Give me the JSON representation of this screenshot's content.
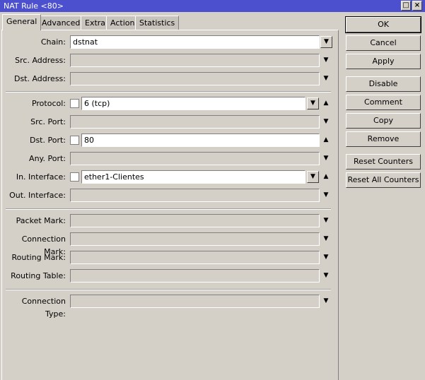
{
  "window": {
    "title": "NAT Rule <80>"
  },
  "tabs": [
    "General",
    "Advanced",
    "Extra",
    "Action",
    "Statistics"
  ],
  "fields": {
    "chain": {
      "label": "Chain:",
      "value": "dstnat"
    },
    "src_address": {
      "label": "Src. Address:",
      "value": ""
    },
    "dst_address": {
      "label": "Dst. Address:",
      "value": ""
    },
    "protocol": {
      "label": "Protocol:",
      "value": "6 (tcp)"
    },
    "src_port": {
      "label": "Src. Port:",
      "value": ""
    },
    "dst_port": {
      "label": "Dst. Port:",
      "value": "80"
    },
    "any_port": {
      "label": "Any. Port:",
      "value": ""
    },
    "in_interface": {
      "label": "In. Interface:",
      "value": "ether1-Clientes"
    },
    "out_interface": {
      "label": "Out. Interface:",
      "value": ""
    },
    "packet_mark": {
      "label": "Packet Mark:",
      "value": ""
    },
    "connection_mark": {
      "label": "Connection Mark:",
      "value": ""
    },
    "routing_mark": {
      "label": "Routing Mark:",
      "value": ""
    },
    "routing_table": {
      "label": "Routing Table:",
      "value": ""
    },
    "connection_type": {
      "label": "Connection Type:",
      "value": ""
    }
  },
  "buttons": {
    "ok": "OK",
    "cancel": "Cancel",
    "apply": "Apply",
    "disable": "Disable",
    "comment": "Comment",
    "copy": "Copy",
    "remove": "Remove",
    "reset_counters": "Reset Counters",
    "reset_all_counters": "Reset All Counters"
  }
}
